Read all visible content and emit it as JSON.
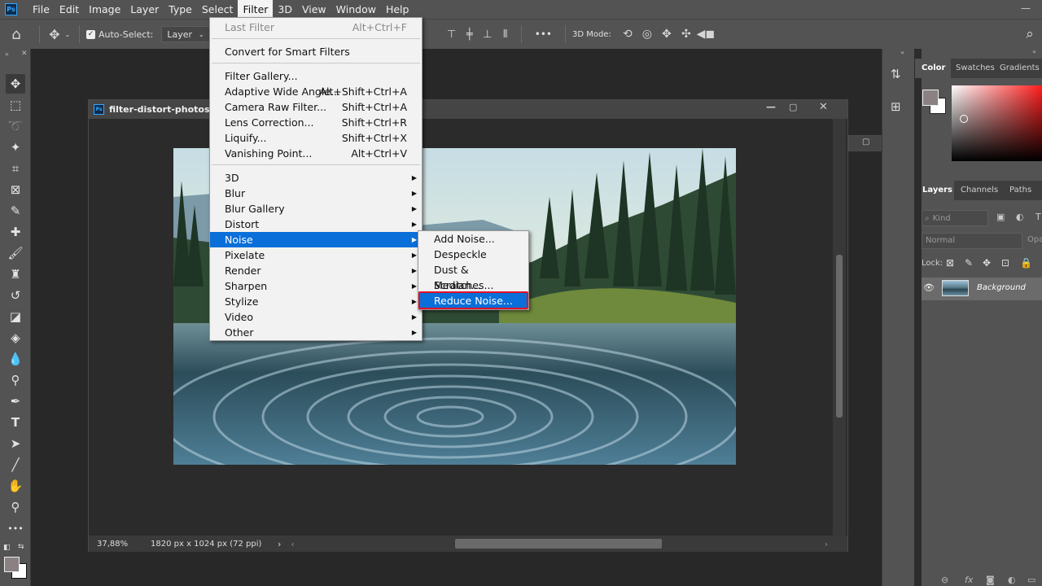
{
  "app": {
    "logo": "Ps",
    "menus": [
      "File",
      "Edit",
      "Image",
      "Layer",
      "Type",
      "Select",
      "Filter",
      "3D",
      "View",
      "Window",
      "Help"
    ],
    "active_menu": "Filter"
  },
  "options_bar": {
    "auto_select_label": "Auto-Select:",
    "auto_select_checked": true,
    "layer_dropdown": "Layer",
    "three_d_mode_label": "3D Mode:",
    "more_label": "•••"
  },
  "document": {
    "title": "filter-distort-photoshop",
    "zoom": "37,88%",
    "dimensions": "1820 px x 1024 px (72 ppi)"
  },
  "filter_menu": {
    "last_filter": {
      "label": "Last Filter",
      "shortcut": "Alt+Ctrl+F"
    },
    "convert_smart": "Convert for Smart Filters",
    "group2": [
      {
        "label": "Filter Gallery...",
        "shortcut": ""
      },
      {
        "label": "Adaptive Wide Angle...",
        "shortcut": "Alt+Shift+Ctrl+A"
      },
      {
        "label": "Camera Raw Filter...",
        "shortcut": "Shift+Ctrl+A"
      },
      {
        "label": "Lens Correction...",
        "shortcut": "Shift+Ctrl+R"
      },
      {
        "label": "Liquify...",
        "shortcut": "Shift+Ctrl+X"
      },
      {
        "label": "Vanishing Point...",
        "shortcut": "Alt+Ctrl+V"
      }
    ],
    "submenus": [
      "3D",
      "Blur",
      "Blur Gallery",
      "Distort",
      "Noise",
      "Pixelate",
      "Render",
      "Sharpen",
      "Stylize",
      "Video",
      "Other"
    ],
    "highlighted_submenu": "Noise"
  },
  "noise_menu": {
    "items": [
      "Add Noise...",
      "Despeckle",
      "Dust & Scratches...",
      "Median...",
      "Reduce Noise..."
    ],
    "highlighted": "Reduce Noise..."
  },
  "right_panel": {
    "color_tabs": [
      "Color",
      "Swatches",
      "Gradients"
    ],
    "layers_tabs": [
      "Layers",
      "Channels",
      "Paths"
    ],
    "kind_label": "Kind",
    "blend_mode": "Normal",
    "opacity_label": "Opa",
    "lock_label": "Lock:",
    "layer_name": "Background"
  },
  "colors": {
    "highlight": "#0a6fd8",
    "outline": "#e0112b",
    "foreground_swatch": "#8a8282",
    "background_swatch": "#ffffff"
  }
}
